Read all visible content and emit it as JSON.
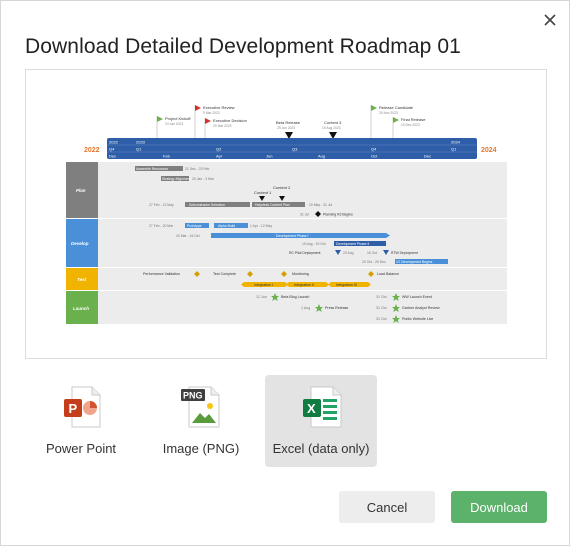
{
  "dialog": {
    "title": "Download Detailed Development Roadmap 01",
    "close_icon": "close-icon"
  },
  "formats": [
    {
      "label": "Power Point",
      "icon": "powerpoint-file-icon",
      "badge": "P",
      "selected": false
    },
    {
      "label": "Image (PNG)",
      "icon": "png-image-file-icon",
      "badge": "PNG",
      "selected": false
    },
    {
      "label": "Excel (data only)",
      "icon": "excel-file-icon",
      "badge": "X",
      "selected": true
    }
  ],
  "buttons": {
    "cancel": "Cancel",
    "download": "Download"
  },
  "colors": {
    "accent_green": "#5cb26a",
    "timeline_blue": "#2f5ea8",
    "plan_gray": "#7f7f7f",
    "develop_blue": "#4a90d9",
    "test_gold": "#f0b400",
    "launch_green": "#6ab04c",
    "year_orange": "#e8772e"
  },
  "roadmap": {
    "years": {
      "start": "2022",
      "end": "2024"
    },
    "timeline_rows": {
      "years_row": [
        "2022",
        "2023",
        "2024"
      ],
      "quarters_row": [
        "Q4",
        "Q1",
        "Q2",
        "Q3",
        "Q4",
        "Q1"
      ],
      "months_row": [
        "Dec",
        "Feb",
        "Apr",
        "Jun",
        "Aug",
        "Oct",
        "Dec"
      ]
    },
    "milestones_top": [
      {
        "label": "Project Kickoff",
        "date": "24 Jan 2023"
      },
      {
        "label": "Executive Review",
        "date": "9 Mar 2023"
      },
      {
        "label": "Executive Decision",
        "date": "20 Mar 2023"
      },
      {
        "label": "Beta Release",
        "date": "29 Jun 2023"
      },
      {
        "label": "Content 3",
        "date": "19 Aug 2023"
      },
      {
        "label": "Release Candidate",
        "date": "20 Nov 2023"
      },
      {
        "label": "Final Release",
        "date": "19 Dec 2023"
      }
    ],
    "swimlanes": [
      {
        "name": "Plan",
        "items": [
          {
            "label": "Assemble Resources",
            "date": "21 Dec - 23 Feb"
          },
          {
            "label": "Strategy Alignment",
            "date": "20 Jan - 3 Mar"
          },
          {
            "label": "Content 1",
            "date": ""
          },
          {
            "label": "Content 2",
            "date": ""
          },
          {
            "label": "Subcontractor Selection",
            "date": "27 Feb - 12 May"
          },
          {
            "label": "Helpdesk Content Plan",
            "date": "19 May - 31 Jul"
          },
          {
            "label": "Planning R2 Begins",
            "date": "31 Jul"
          }
        ]
      },
      {
        "name": "Develop",
        "items": [
          {
            "label": "Prototype",
            "date": "27 Feb - 20 Mar"
          },
          {
            "label": "Alpha Build",
            "date": "1 Apr - 12 May"
          },
          {
            "label": "Development Phase I",
            "date": "20 Mar - 16 Oct"
          },
          {
            "label": "Development Phase II",
            "date": "19 Aug - 19 Oct"
          },
          {
            "label": "RC Pilot Deployment",
            "date": "23 Aug"
          },
          {
            "label": "RTW Deployment",
            "date": "16 Oct"
          },
          {
            "label": "V2 Development Begins",
            "date": "20 Oct - 28 Dec"
          }
        ]
      },
      {
        "name": "Test",
        "items": [
          {
            "label": "Performance Validation",
            "date": ""
          },
          {
            "label": "Test Complete",
            "date": ""
          },
          {
            "label": "Monitoring",
            "date": ""
          },
          {
            "label": "Load Balance",
            "date": ""
          },
          {
            "label": "Integration I",
            "date": ""
          },
          {
            "label": "Integration II",
            "date": ""
          },
          {
            "label": "Integration III",
            "date": ""
          }
        ]
      },
      {
        "name": "Launch",
        "items": [
          {
            "label": "Beta Blog Launch",
            "date": "12 Jun"
          },
          {
            "label": "Press Release",
            "date": "1 Aug"
          },
          {
            "label": "WW Launch Event",
            "date": "31 Oct"
          },
          {
            "label": "Gartner Analyst Review",
            "date": "31 Oct"
          },
          {
            "label": "Public Website Live",
            "date": "31 Oct"
          }
        ]
      }
    ]
  }
}
